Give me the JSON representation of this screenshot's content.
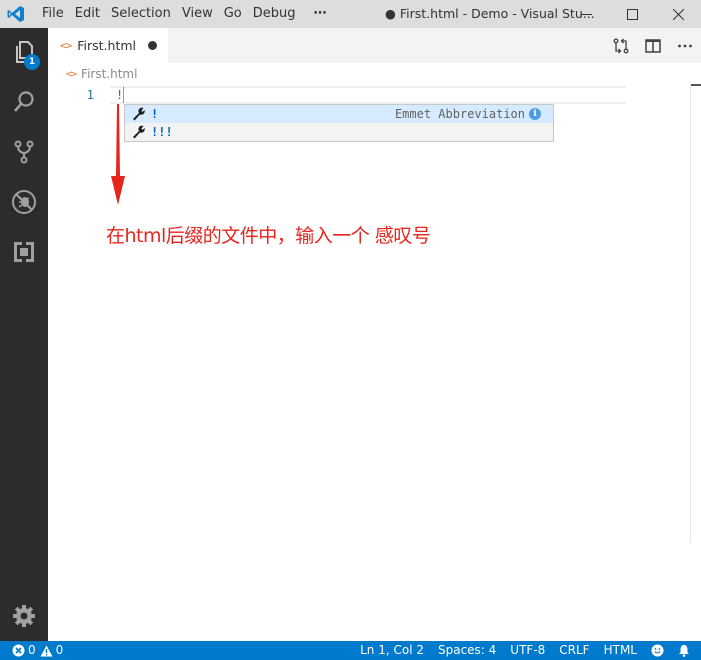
{
  "titlebar": {
    "menu": [
      "File",
      "Edit",
      "Selection",
      "View",
      "Go",
      "Debug",
      "⋯"
    ],
    "window_title": "● First.html - Demo - Visual Stu...",
    "minimize_glyph": "—",
    "maximize_glyph": "☐",
    "close_glyph": "✕"
  },
  "activitybar": {
    "items": [
      {
        "name": "explorer",
        "icon": "files-icon",
        "badge": "1"
      },
      {
        "name": "search",
        "icon": "search-icon"
      },
      {
        "name": "source-control",
        "icon": "source-control-icon"
      },
      {
        "name": "debug",
        "icon": "debug-icon"
      },
      {
        "name": "extensions",
        "icon": "extensions-icon"
      }
    ],
    "settings_icon": "gear-icon"
  },
  "tabs": [
    {
      "label": "First.html",
      "icon": "<>",
      "dirty": true
    }
  ],
  "tab_actions": [
    "open-changes",
    "split-editor",
    "more-actions"
  ],
  "breadcrumb": {
    "icon": "<>",
    "label": "First.html"
  },
  "editor": {
    "lines": [
      {
        "number": "1",
        "text": "!"
      }
    ]
  },
  "suggestions": [
    {
      "label": "!",
      "detail": "Emmet Abbreviation",
      "selected": true
    },
    {
      "label": "!!!",
      "detail": "",
      "selected": false
    }
  ],
  "annotation": {
    "text": "在html后缀的文件中，输入一个 感叹号",
    "color": "#e8251d"
  },
  "statusbar": {
    "errors": "0",
    "warnings": "0",
    "position": "Ln 1, Col 2",
    "spaces": "Spaces: 4",
    "encoding": "UTF-8",
    "eol": "CRLF",
    "language": "HTML"
  },
  "colors": {
    "accent": "#007acc",
    "activitybar": "#2c2c2c",
    "titlebar": "#dddddd"
  }
}
